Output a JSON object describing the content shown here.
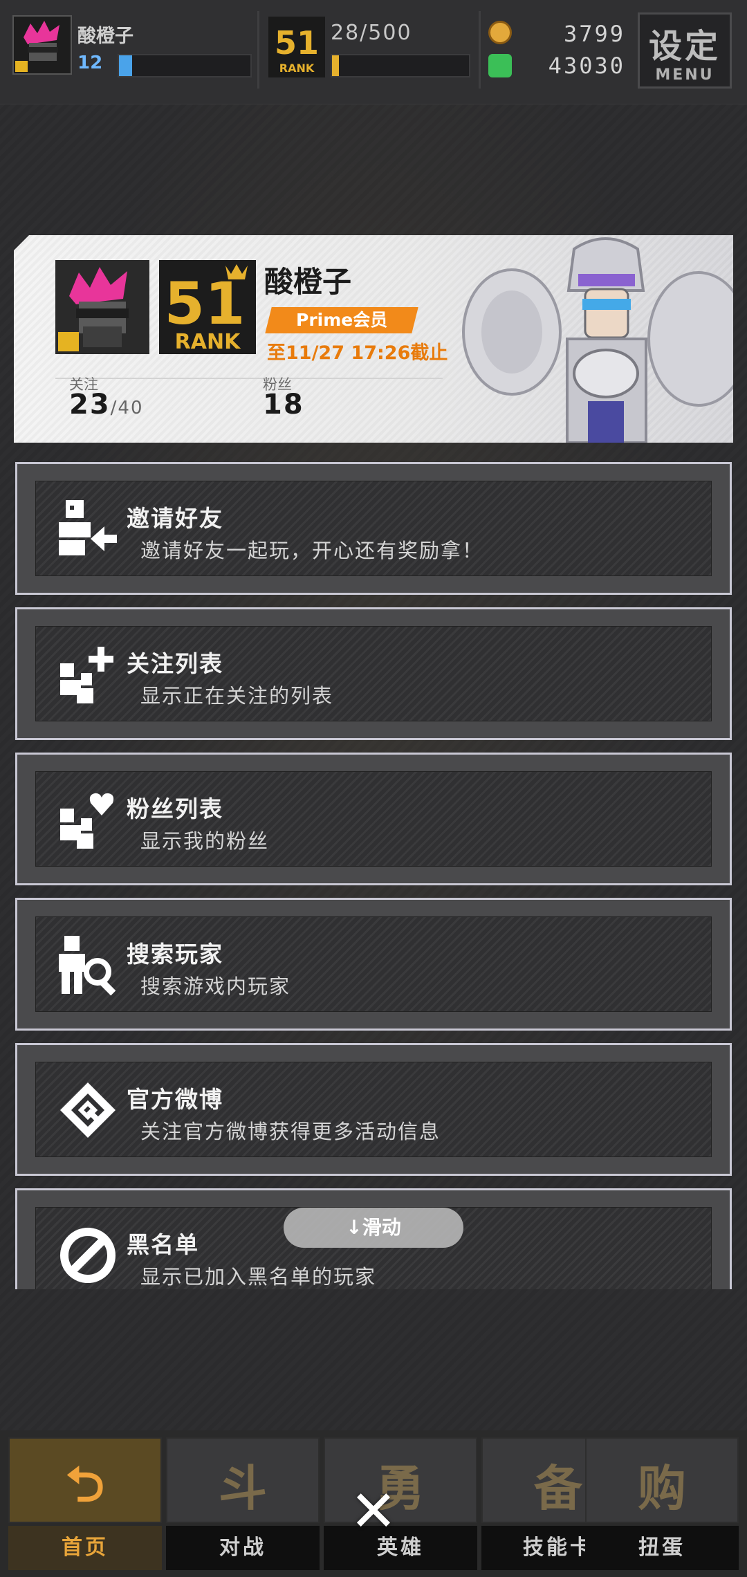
{
  "status_bar": {
    "player_name": "酸橙子",
    "level": "12",
    "level_progress": 0.1,
    "rank_count": "28/500",
    "rank_progress": 0.05,
    "gold": "3799",
    "gems": "43030",
    "menu_big": "设定",
    "menu_small": "MENU"
  },
  "profile": {
    "name": "酸橙子",
    "rank_number": "51",
    "rank_word": "RANK",
    "prime_label": "Prime会员",
    "expire_text": "至11/27 17:26截止",
    "follow_label": "关注",
    "follow_count": "23",
    "follow_max": "/40",
    "fans_label": "粉丝",
    "fans_count": "18"
  },
  "menu_items": [
    {
      "title": "邀请好友",
      "subtitle": "邀请好友一起玩，开心还有奖励拿！",
      "icon": "invite-friend-icon"
    },
    {
      "title": "关注列表",
      "subtitle": "显示正在关注的列表",
      "icon": "follow-list-icon"
    },
    {
      "title": "粉丝列表",
      "subtitle": "显示我的粉丝",
      "icon": "fans-list-icon"
    },
    {
      "title": "搜索玩家",
      "subtitle": "搜索游戏内玩家",
      "icon": "search-player-icon"
    },
    {
      "title": "官方微博",
      "subtitle": "关注官方微博获得更多活动信息",
      "icon": "weibo-icon"
    },
    {
      "title": "黑名单",
      "subtitle": "显示已加入黑名单的玩家",
      "icon": "blacklist-icon"
    }
  ],
  "swipe_hint": "↓滑动",
  "bottom_nav": [
    {
      "label": "首页",
      "glyph": "⮌"
    },
    {
      "label": "对战",
      "glyph": "斗"
    },
    {
      "label": "英雄",
      "glyph": "勇"
    },
    {
      "label": "技能卡",
      "glyph": "备"
    },
    {
      "label": "扭蛋",
      "glyph": "购"
    }
  ],
  "close_symbol": "✕",
  "colors": {
    "accent_orange": "#f28a1a",
    "rank_gold": "#e6b12d",
    "level_blue": "#4aa3ea",
    "item_border": "#c9c8d4"
  }
}
